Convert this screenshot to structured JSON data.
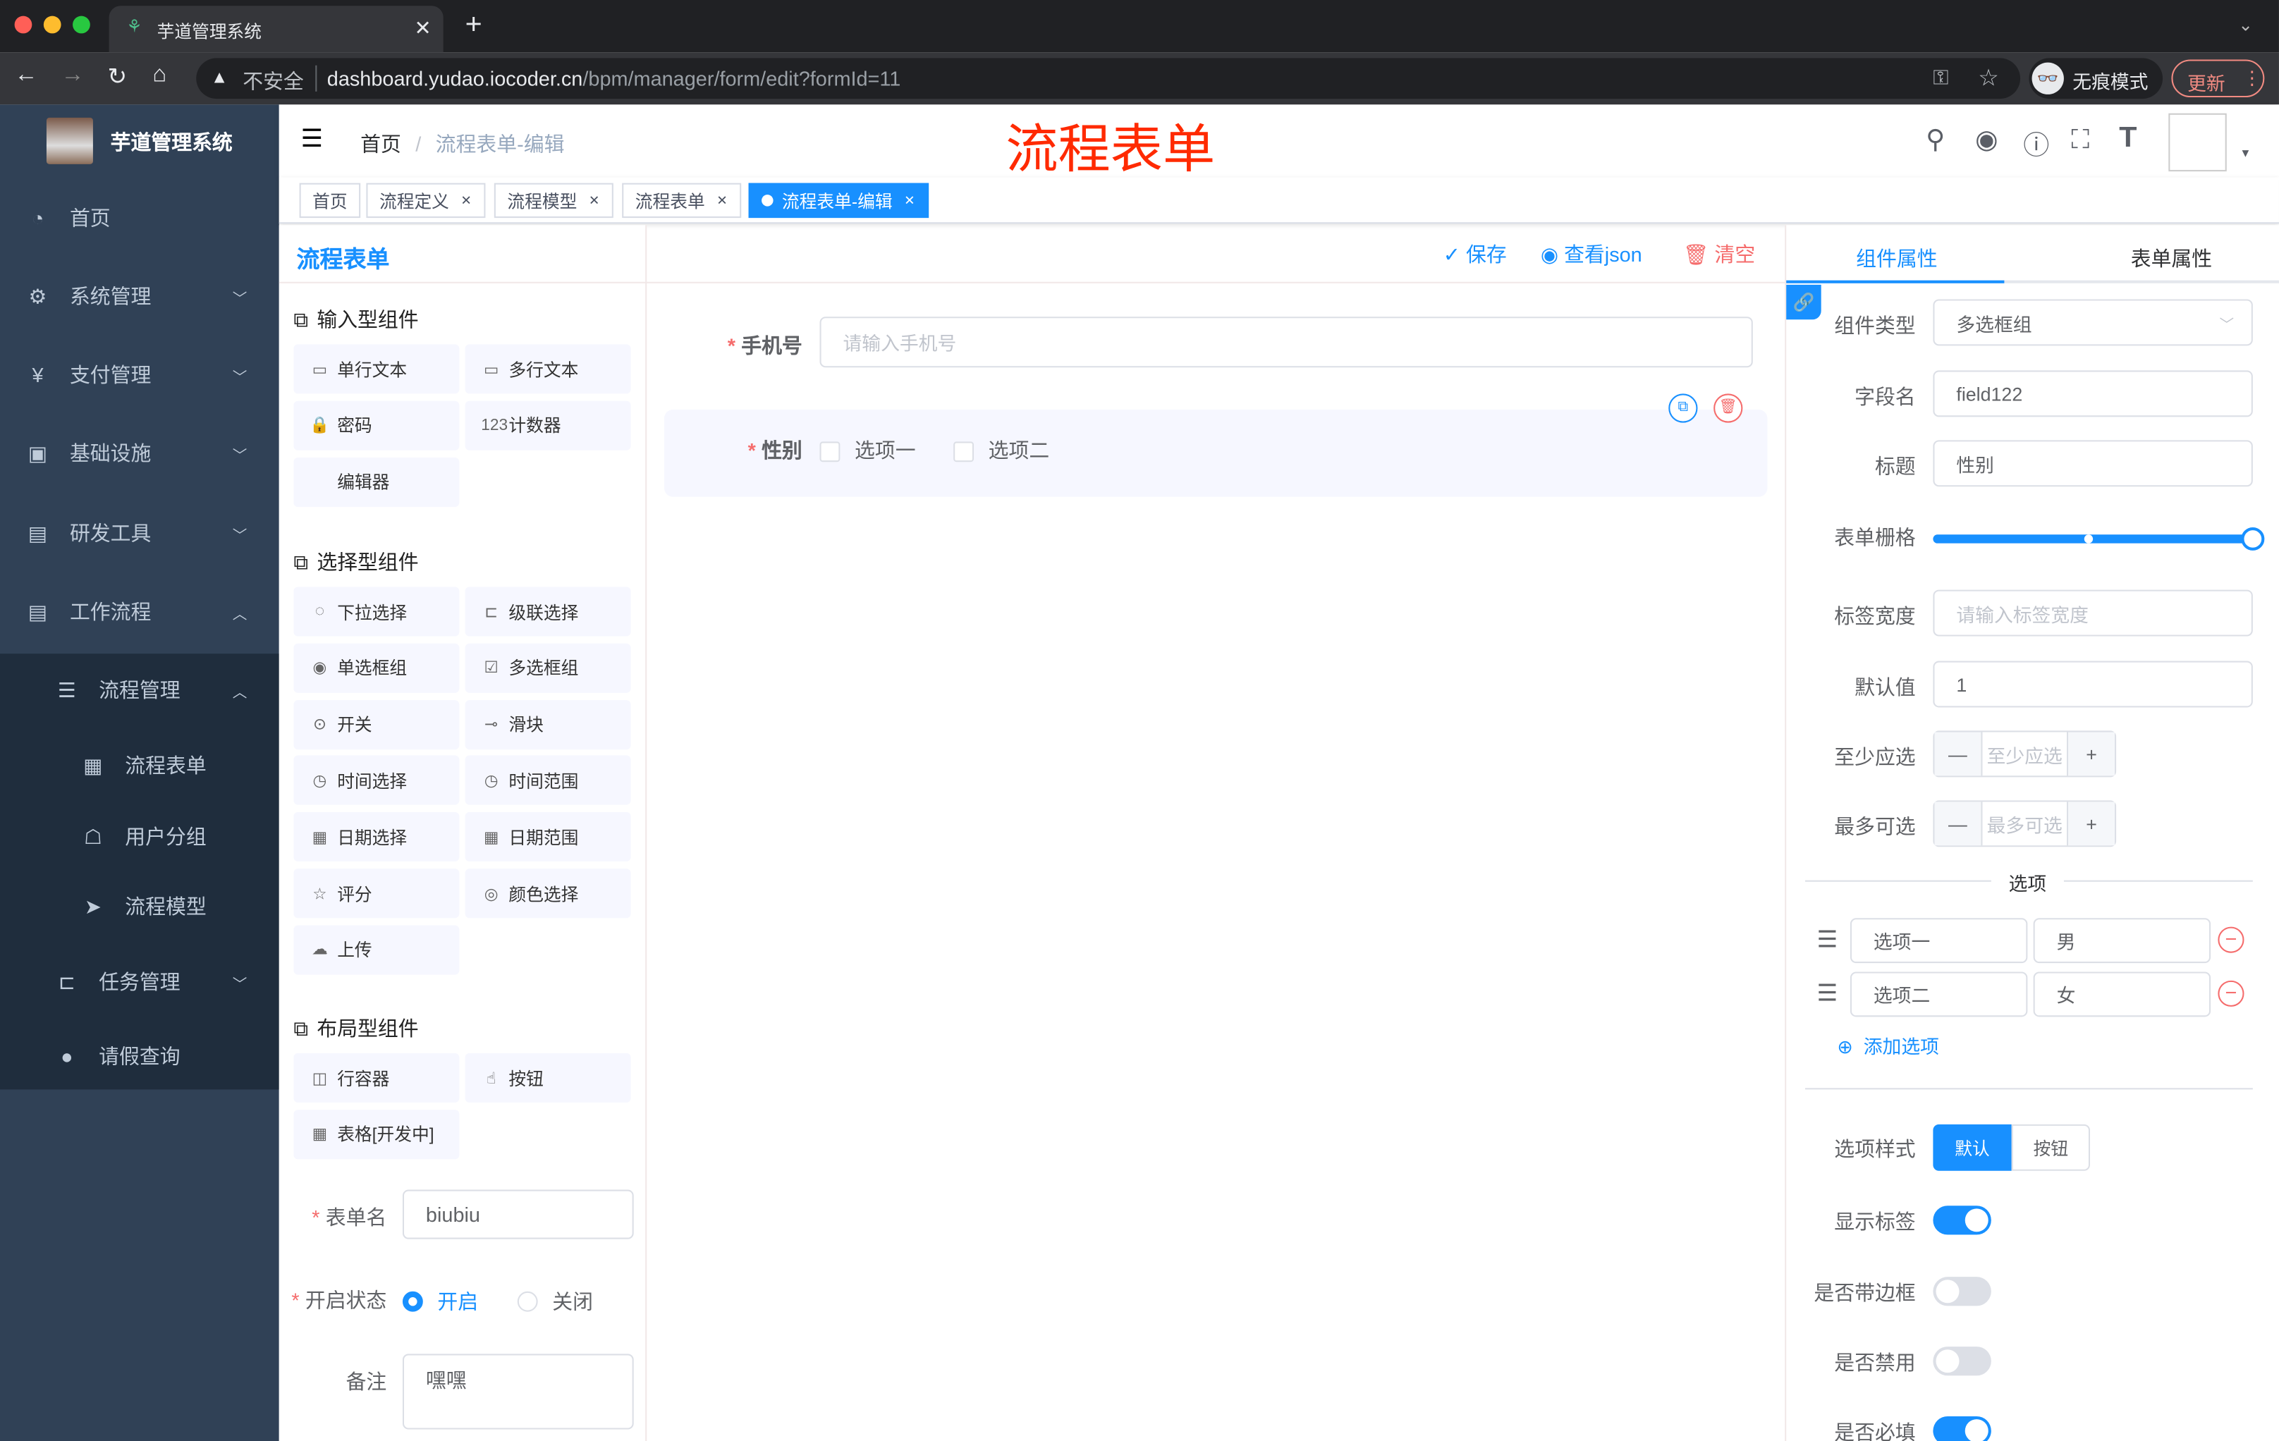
{
  "browser": {
    "tab_title": "芋道管理系统",
    "insecure_label": "不安全",
    "url_host": "dashboard.yudao.iocoder.cn",
    "url_path": "/bpm/manager/form/edit?formId=11",
    "incognito_label": "无痕模式",
    "update_label": "更新"
  },
  "sidebar": {
    "logo_title": "芋道管理系统",
    "items": [
      {
        "label": "首页",
        "icon": "dashboard-icon"
      },
      {
        "label": "系统管理",
        "icon": "gear-icon"
      },
      {
        "label": "支付管理",
        "icon": "yen-icon"
      },
      {
        "label": "基础设施",
        "icon": "monitor-icon"
      },
      {
        "label": "研发工具",
        "icon": "toolbox-icon"
      },
      {
        "label": "工作流程",
        "icon": "toolbox-icon"
      },
      {
        "label": "流程管理",
        "icon": "list-icon"
      },
      {
        "label": "流程表单",
        "icon": "form-icon"
      },
      {
        "label": "用户分组",
        "icon": "group-icon"
      },
      {
        "label": "流程模型",
        "icon": "send-icon"
      },
      {
        "label": "任务管理",
        "icon": "tree-icon"
      },
      {
        "label": "请假查询",
        "icon": "user-icon"
      }
    ]
  },
  "navbar": {
    "breadcrumb": [
      "首页",
      "流程表单-编辑"
    ],
    "overlay_title": "流程表单"
  },
  "tags": [
    {
      "label": "首页"
    },
    {
      "label": "流程定义"
    },
    {
      "label": "流程模型"
    },
    {
      "label": "流程表单"
    },
    {
      "label": "流程表单-编辑",
      "active": true
    }
  ],
  "left": {
    "title": "流程表单",
    "sections": [
      {
        "title": "输入型组件",
        "items": [
          "单行文本",
          "多行文本",
          "密码",
          "计数器",
          "编辑器"
        ]
      },
      {
        "title": "选择型组件",
        "items": [
          "下拉选择",
          "级联选择",
          "单选框组",
          "多选框组",
          "开关",
          "滑块",
          "时间选择",
          "时间范围",
          "日期选择",
          "日期范围",
          "评分",
          "颜色选择",
          "上传"
        ]
      },
      {
        "title": "布局型组件",
        "items": [
          "行容器",
          "按钮",
          "表格[开发中]"
        ]
      }
    ],
    "form": {
      "name_label": "表单名",
      "name_value": "biubiu",
      "status_label": "开启状态",
      "status_on": "开启",
      "status_off": "关闭",
      "status_selected": "开启",
      "remark_label": "备注",
      "remark_value": "嘿嘿"
    }
  },
  "toolbar": {
    "save": "保存",
    "view_json": "查看json",
    "clear": "清空"
  },
  "canvas": {
    "phone_label": "手机号",
    "phone_placeholder": "请输入手机号",
    "gender_label": "性别",
    "options": [
      "选项一",
      "选项二"
    ]
  },
  "right": {
    "tabs": [
      "组件属性",
      "表单属性"
    ],
    "active_tab": "组件属性",
    "fields": {
      "type_label": "组件类型",
      "type_value": "多选框组",
      "field_label": "字段名",
      "field_value": "field122",
      "title_label": "标题",
      "title_value": "性别",
      "grid_label": "表单栅格",
      "grid_value": 24,
      "grid_max": 24,
      "label_width_label": "标签宽度",
      "label_width_placeholder": "请输入标签宽度",
      "default_label": "默认值",
      "default_value": "1",
      "min_label": "至少应选",
      "min_placeholder": "至少应选",
      "max_label": "最多可选",
      "max_placeholder": "最多可选"
    },
    "options_divider": "选项",
    "options": [
      {
        "label": "选项一",
        "value": "男"
      },
      {
        "label": "选项二",
        "value": "女"
      }
    ],
    "add_option": "添加选项",
    "style_label": "选项样式",
    "style_options": [
      "默认",
      "按钮"
    ],
    "style_selected": "默认",
    "show_label": "显示标签",
    "show_label_on": true,
    "border_label": "是否带边框",
    "border_on": false,
    "disabled_label": "是否禁用",
    "disabled_on": false,
    "required_label": "是否必填",
    "required_on": true
  },
  "colors": {
    "primary": "#1890ff",
    "sidebar": "#304156",
    "danger": "#f56c6c",
    "title_red": "#ff2a00"
  }
}
